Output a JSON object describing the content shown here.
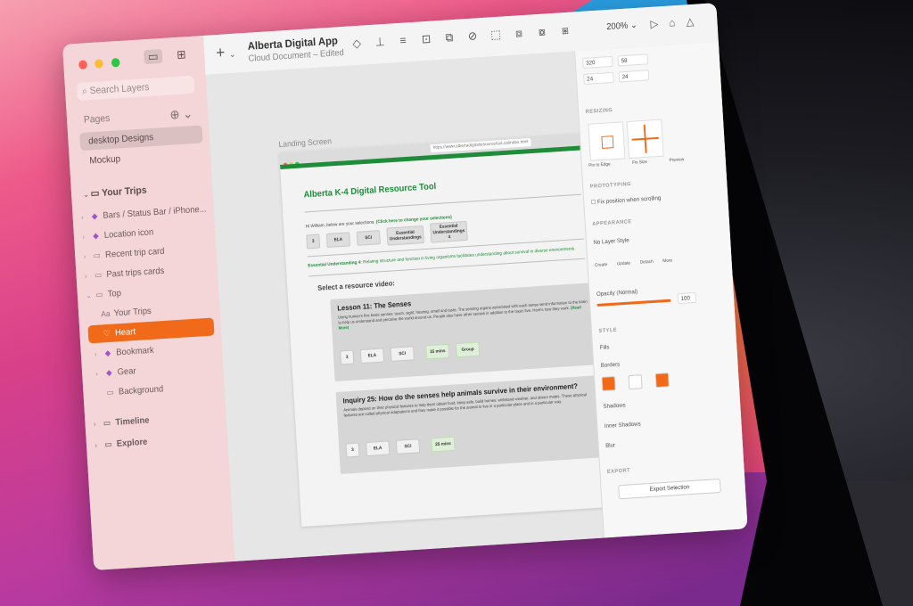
{
  "app": {
    "title": "Alberta Digital App",
    "subtitle": "Cloud Document – Edited",
    "zoom": "200%"
  },
  "sidebar": {
    "search_placeholder": "Search Layers",
    "pages_label": "Pages",
    "pages": [
      "desktop Designs",
      "Mockup"
    ],
    "section_title": "Your Trips",
    "layers": [
      {
        "label": "Bars / Status Bar / iPhone...",
        "icon": "symbol-icon"
      },
      {
        "label": "Location icon",
        "icon": "symbol-icon"
      },
      {
        "label": "Recent trip card",
        "icon": "group-icon"
      },
      {
        "label": "Past trips cards",
        "icon": "group-icon"
      },
      {
        "label": "Top",
        "icon": "group-icon"
      },
      {
        "label": "Your Trips",
        "icon": "text-icon"
      },
      {
        "label": "Heart",
        "icon": "heart-icon"
      },
      {
        "label": "Bookmark",
        "icon": "symbol-icon"
      },
      {
        "label": "Gear",
        "icon": "symbol-icon"
      },
      {
        "label": "Background",
        "icon": "rectangle-icon"
      }
    ],
    "bottom_sections": [
      "Timeline",
      "Explore"
    ]
  },
  "canvas": {
    "artboard_label": "Landing Screen",
    "url": "https://www.albertadigitalresourcetool.ca/index.html",
    "site_title": "Alberta K-4 Digital Resource Tool",
    "greeting_prefix": "Hi William, below are your selections: ",
    "greeting_link": "(Click here to change your selections)",
    "selection_chips": [
      "3",
      "ELA",
      "SCI",
      "Essential Understandings",
      "Essential Understandings 4"
    ],
    "eu_label": "Essential Understanding 4:",
    "eu_text": " Relating structure and function in living organisms facilitates understanding about survival in diverse environments",
    "select_prompt": "Select a resource video:",
    "cards": [
      {
        "title": "Lesson 11: The Senses",
        "text": "Using human's five basic senses: touch, sight, hearing, smell and taste. The sensing organs associated with each sense send information to the brain to help us understand and perceive the world around us. People also have other senses in addition to the basic five. Here's how they work. ",
        "read_more": "(Read More)",
        "chips": [
          "3",
          "ELA",
          "SCI",
          "15 mins",
          "Group"
        ]
      },
      {
        "title": "Inquiry 25: How do the senses help animals survive in their environment?",
        "text": "Animals depend on their physical features to help them obtain food, keep safe, build homes, withstand weather, and attract mates. These physical features are called physical adaptations and they make it possible for the animal to live in a particular place and in a particular way.",
        "read_more": "",
        "chips": [
          "3",
          "ELA",
          "SCI",
          "25 mins"
        ]
      }
    ]
  },
  "inspector": {
    "x": "320",
    "y": "58",
    "w": "24",
    "h": "24",
    "resizing_label": "RESIZING",
    "pin_label": "Pin to Edge",
    "fix_label": "Fix Size",
    "preview_label": "Preview",
    "prototyping_label": "PROTOTYPING",
    "fix_position_label": "Fix position when scrolling",
    "appearance_label": "APPEARANCE",
    "layer_style": "No Layer Style",
    "actions": [
      "Create",
      "Update",
      "Detach",
      "More"
    ],
    "opacity_label": "Opacity (Normal)",
    "opacity_value": "100",
    "opacity_fraction": 1.0,
    "style_label": "STYLE",
    "fills_label": "Fills",
    "borders_label": "Borders",
    "shadows_label": "Shadows",
    "inner_shadows_label": "Inner Shadows",
    "blur_label": "Blur",
    "export_label": "EXPORT",
    "export_button": "Export Selection",
    "accent": "#f06a1a",
    "site_green": "#1f8c3a"
  }
}
